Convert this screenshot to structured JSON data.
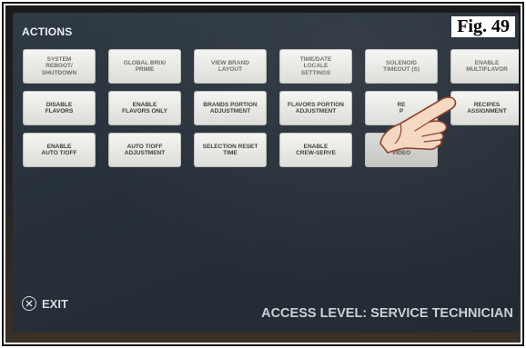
{
  "figure_label": "Fig. 49",
  "actions_title": "ACTIONS",
  "tiles": [
    {
      "label": "SYSTEM\nREBOOT/\nSHUTDOWN"
    },
    {
      "label": "GLOBAL BRIX/\nPRIME"
    },
    {
      "label": "VIEW BRAND\nLAYOUT"
    },
    {
      "label": "TIME/DATE\nLOCALE\nSETTINGS"
    },
    {
      "label": "SOLENOID\nTIMEOUT (S)"
    },
    {
      "label": "ENABLE\nMULTIFLAVOR"
    },
    {
      "label": "DISABLE\nFLAVORS"
    },
    {
      "label": "ENABLE\nFLAVORS ONLY"
    },
    {
      "label": "BRANDS PORTION\nADJUSTMENT"
    },
    {
      "label": "FLAVORS PORTION\nADJUSTMENT"
    },
    {
      "label": "RE\nP"
    },
    {
      "label": "RECIPES\nASSIGNMENT"
    },
    {
      "label": "ENABLE\nAUTO T/OFF"
    },
    {
      "label": "AUTO T/OFF\nADJUSTMENT"
    },
    {
      "label": "SELECTION RESET\nTIME"
    },
    {
      "label": "ENABLE\nCREW-SERVE"
    },
    {
      "label": "ENABLE\nVIDEO"
    }
  ],
  "exit_label": "EXIT",
  "access_level": "ACCESS LEVEL: SERVICE TECHNICIAN",
  "icons": {
    "exit": "close-x-icon",
    "pointer": "pointing-hand-icon"
  },
  "colors": {
    "screen_bg": "#27303a",
    "tile_bg": "#e8e8e5",
    "tile_text": "#6b6b6b",
    "ui_text": "#d8dde2"
  }
}
